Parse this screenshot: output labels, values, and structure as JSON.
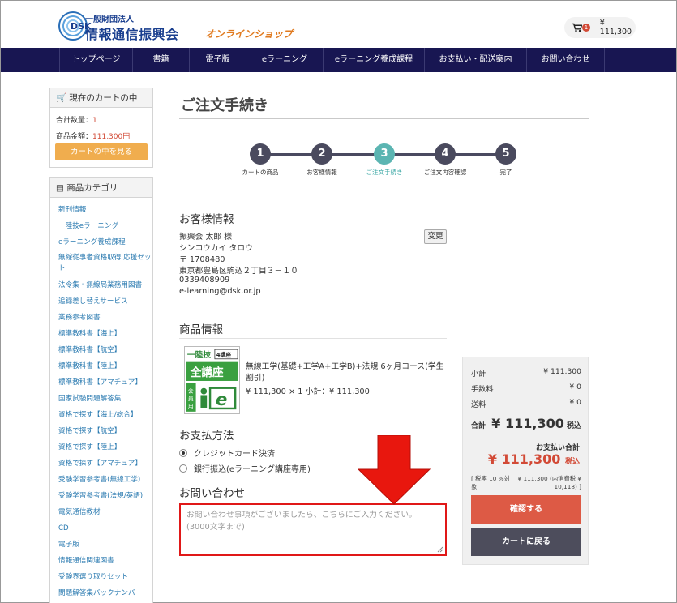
{
  "header": {
    "logo_text": "DSK",
    "org_small": "一般財団法人",
    "org_main": "情報通信振興会",
    "org_shop": "オンラインショップ",
    "cart_count": "1",
    "cart_amount": "¥ 111,300"
  },
  "nav": [
    "トップページ",
    "書籍",
    "電子版",
    "eラーニング",
    "eラーニング養成課程",
    "お支払い・配送案内",
    "お問い合わせ"
  ],
  "sidebar": {
    "cart_title": "現在のカートの中",
    "count_label": "合計数量：",
    "count_value": "1",
    "amount_label": "商品金額：",
    "amount_value": "111,300円",
    "view_cart_button": "カートの中を見る",
    "category_title": "商品カテゴリ",
    "categories": [
      "新刊情報",
      "一陸技eラーニング",
      "eラーニング養成課程",
      "無線従事者資格取得 応援セット",
      "法令集・無線局業務用図書",
      "追録差し替えサービス",
      "業務参考図書",
      "標準教科書【海上】",
      "標準教科書【航空】",
      "標準教科書【陸上】",
      "標準教科書【アマチュア】",
      "国家試験問題解答集",
      "資格で探す【海上/総合】",
      "資格で探す【航空】",
      "資格で探す【陸上】",
      "資格で探す【アマチュア】",
      "受験学習参考書(無線工学)",
      "受験学習参考書(法規/英語)",
      "電気通信教材",
      "CD",
      "電子版",
      "情報通信関連図書",
      "受験界選り取りセット",
      "問題解答集バックナンバー"
    ]
  },
  "main": {
    "page_title": "ご注文手続き",
    "steps": [
      {
        "num": "1",
        "label": "カートの商品"
      },
      {
        "num": "2",
        "label": "お客様情報"
      },
      {
        "num": "3",
        "label": "ご注文手続き"
      },
      {
        "num": "4",
        "label": "ご注文内容確認"
      },
      {
        "num": "5",
        "label": "完了"
      }
    ],
    "active_step": 3,
    "customer": {
      "title": "お客様情報",
      "lines": [
        "振興会 太郎 様",
        "シンコウカイ タロウ",
        "〒 1708480",
        "東京都豊島区駒込２丁目３－１０",
        "0339408909",
        "e-learning@dsk.or.jp"
      ],
      "change_button": "変更"
    },
    "product": {
      "title": "商品情報",
      "image_text": {
        "top": "一陸技",
        "badge": "4講座",
        "mid": "全講座",
        "side": "会員用",
        "letter": "e"
      },
      "name": "無線工学(基礎+工学A+工学B)+法規 6ヶ月コース(学生割引)",
      "price_line": "¥ 111,300 × 1  小計：¥ 111,300"
    },
    "payment": {
      "title": "お支払方法",
      "options": [
        {
          "label": "クレジットカード決済",
          "selected": true
        },
        {
          "label": "銀行振込(eラーニング講座専用)",
          "selected": false
        }
      ]
    },
    "inquiry": {
      "title": "お問い合わせ",
      "placeholder_line1": "お問い合わせ事項がございましたら、こちらにご入力ください。",
      "placeholder_line2": "(3000文字まで)"
    }
  },
  "summary": {
    "subtotal_label": "小計",
    "subtotal_value": "¥ 111,300",
    "fee_label": "手数料",
    "fee_value": "¥ 0",
    "shipping_label": "送料",
    "shipping_value": "¥ 0",
    "total_label": "合計",
    "total_value": "¥ 111,300",
    "tax_incl": "税込",
    "pay_total_label": "お支払い合計",
    "pay_total_value": "¥ 111,300",
    "tax_rate_label": "[ 税率 10 %対象",
    "tax_rate_value": "¥ 111,300 (内消費税 ¥ 10,118) ]",
    "confirm_button": "確認する",
    "back_button": "カートに戻る"
  },
  "colors": {
    "nav": "#181652",
    "accent_orange": "#f0ad4e",
    "accent_red": "#dd5a45",
    "teal": "#5bb5b2",
    "highlight_border": "#e01818",
    "arrow": "#e8170e"
  }
}
